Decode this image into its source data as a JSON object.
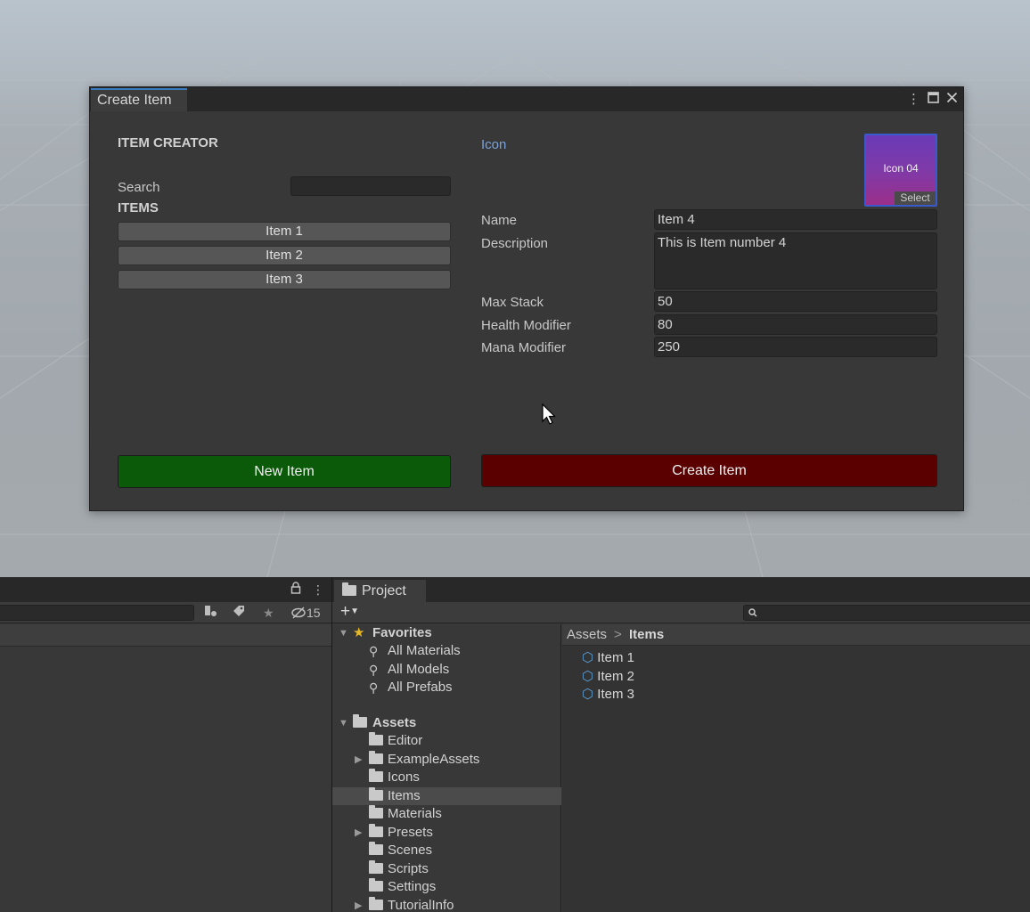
{
  "window": {
    "tab_title": "Create Item",
    "controls": {
      "menu": "⋮",
      "maximize": "□",
      "close": "✕"
    }
  },
  "creator": {
    "heading": "ITEM CREATOR",
    "search_label": "Search",
    "search_value": "",
    "items_heading": "ITEMS",
    "items": [
      "Item 1",
      "Item 2",
      "Item 3"
    ],
    "new_button": "New Item"
  },
  "details": {
    "icon_label": "Icon",
    "icon_preview_text": "Icon 04",
    "icon_select": "Select",
    "name_label": "Name",
    "name_value": "Item 4",
    "description_label": "Description",
    "description_value": "This is Item number 4",
    "max_stack_label": "Max Stack",
    "max_stack_value": "50",
    "health_label": "Health Modifier",
    "health_value": "80",
    "mana_label": "Mana Modifier",
    "mana_value": "250",
    "create_button": "Create Item"
  },
  "colors": {
    "new_button": "#0a5a0a",
    "create_button": "#5a0000",
    "accent_tab": "#3a79bb",
    "icon_label": "#7ba3da"
  },
  "hierarchy_panel": {
    "hidden_count": "15"
  },
  "project": {
    "tab_label": "Project",
    "favorites_label": "Favorites",
    "favorites": [
      "All Materials",
      "All Models",
      "All Prefabs"
    ],
    "assets_label": "Assets",
    "folders": [
      {
        "name": "Editor",
        "expandable": false,
        "selected": false
      },
      {
        "name": "ExampleAssets",
        "expandable": true,
        "selected": false
      },
      {
        "name": "Icons",
        "expandable": false,
        "selected": false
      },
      {
        "name": "Items",
        "expandable": false,
        "selected": true
      },
      {
        "name": "Materials",
        "expandable": false,
        "selected": false
      },
      {
        "name": "Presets",
        "expandable": true,
        "selected": false
      },
      {
        "name": "Scenes",
        "expandable": false,
        "selected": false
      },
      {
        "name": "Scripts",
        "expandable": false,
        "selected": false
      },
      {
        "name": "Settings",
        "expandable": false,
        "selected": false
      },
      {
        "name": "TutorialInfo",
        "expandable": true,
        "selected": false
      }
    ],
    "breadcrumb": [
      "Assets",
      "Items"
    ],
    "assets": [
      "Item 1",
      "Item 2",
      "Item 3"
    ]
  }
}
